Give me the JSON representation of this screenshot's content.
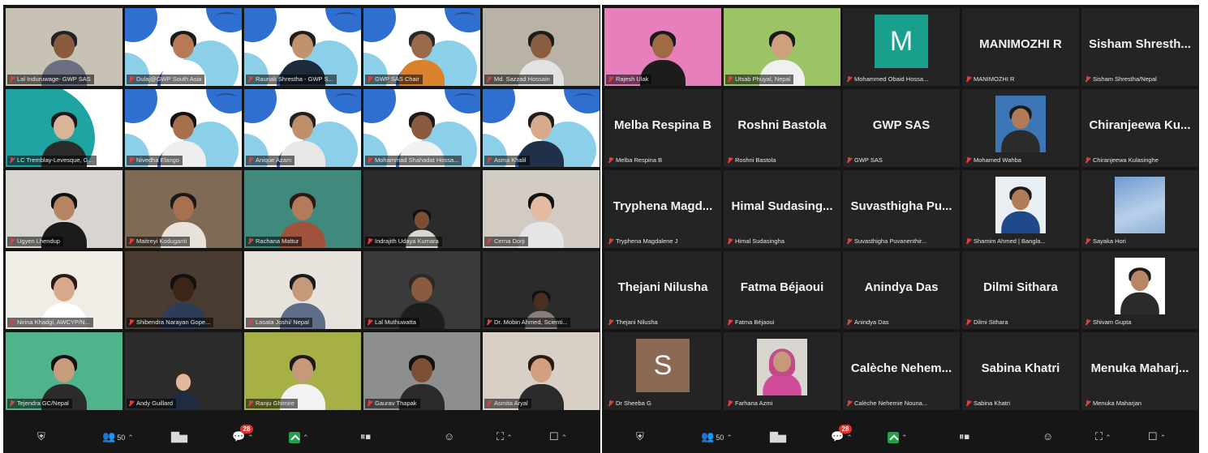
{
  "window": {
    "title": "Zoom meeting gallery view"
  },
  "frames": [
    {
      "id": "left",
      "tiles": [
        {
          "type": "video",
          "name": "Lal Induruwage- GWP SAS",
          "bg": "#c7c2b4",
          "skin": "#8a5a3c",
          "hair": "#222",
          "shirt": "#6b6f82"
        },
        {
          "type": "gwp",
          "name": "Dulaj@GWP South Asia",
          "skin": "#b77a55",
          "hair": "#1a1a1a",
          "shirt": "#ffffff"
        },
        {
          "type": "gwp",
          "name": "Raunak Shrestha - GWP S...",
          "skin": "#c2926c",
          "hair": "#1e1e1e",
          "shirt": "#1d2a3a"
        },
        {
          "type": "gwp",
          "name": "GWP SAS Chair",
          "skin": "#9b6a4d",
          "hair": "#2a2a2a",
          "shirt": "#d9822b"
        },
        {
          "type": "video",
          "name": "Md. Sazzad Hossain",
          "bg": "#b9b2a7",
          "skin": "#8b5d40",
          "hair": "#1b1b1b",
          "shirt": "#e2e2e2"
        },
        {
          "type": "gwp-teal",
          "name": "LC Tremblay-Levesque, G...",
          "skin": "#d7b49a",
          "hair": "#1a1a1a",
          "shirt": "#2b2b2b"
        },
        {
          "type": "gwp",
          "name": "Nivedha Elango",
          "skin": "#a86f4d",
          "hair": "#111",
          "shirt": "#eeeeee"
        },
        {
          "type": "gwp",
          "name": "Anique Azam",
          "skin": "#c08e6a",
          "hair": "#222",
          "shirt": "#e8e8e8"
        },
        {
          "type": "gwp",
          "name": "Mohammad Shahadat Hossa...",
          "skin": "#8a5a3f",
          "hair": "#1a1a1a",
          "shirt": "#f1f1f1",
          "active": true
        },
        {
          "type": "gwp",
          "name": "Asma Khalil",
          "skin": "#d8a98a",
          "hair": "#1d1d1d",
          "shirt": "#203048"
        },
        {
          "type": "video",
          "name": "Ugyen Lhendup",
          "bg": "#d8d4cf",
          "skin": "#b68663",
          "hair": "#111",
          "shirt": "#1b1b1b"
        },
        {
          "type": "video",
          "name": "Maitreyi Koduganti",
          "bg": "#7f6a55",
          "skin": "#a7714f",
          "hair": "#1a1a1a",
          "shirt": "#e9e2da"
        },
        {
          "type": "video",
          "name": "Rachana Mattur",
          "bg": "#3f8a7d",
          "skin": "#b37b5b",
          "hair": "#2a1a12",
          "shirt": "#a0523b"
        },
        {
          "type": "video",
          "name": "Indrajith Udaya Kumara",
          "bg": "#2b2b2b",
          "skin": "#7c4f35",
          "hair": "#111",
          "shirt": "#d9d5cf",
          "small": true
        },
        {
          "type": "video",
          "name": "Cerna Dorji",
          "bg": "#d1cbc3",
          "skin": "#e2bba0",
          "hair": "#111",
          "shirt": "#e5e5e5"
        },
        {
          "type": "video",
          "name": "Nirina Khadgi, AWCYP/N...",
          "bg": "#f0ece6",
          "skin": "#d8a98d",
          "hair": "#2a1a12",
          "shirt": "#ffffff"
        },
        {
          "type": "video",
          "name": "Shibendra Narayan Gope...",
          "bg": "#4a3c31",
          "skin": "#3b2418",
          "hair": "#111",
          "shirt": "#2c3d5a"
        },
        {
          "type": "video",
          "name": "Lasata Joshi/ Nepal",
          "bg": "#e7e3dc",
          "skin": "#c59a7b",
          "hair": "#1a1a1a",
          "shirt": "#5f6e88"
        },
        {
          "type": "video",
          "name": "Lal Muthuwatta",
          "bg": "#3a3a3a",
          "skin": "#8a5b3e",
          "hair": "#2a2a2a",
          "shirt": "#1e1e1e"
        },
        {
          "type": "video",
          "name": "Dr. Mobin Ahmed, Scienti...",
          "bg": "#2b2b2b",
          "skin": "#4a2f20",
          "hair": "#111",
          "shirt": "#8a7e7a",
          "small": true
        },
        {
          "type": "video",
          "name": "Tejendra GC/Nepal",
          "bg": "#4fb48b",
          "skin": "#c99c7c",
          "hair": "#111",
          "shirt": "#2b2b2b"
        },
        {
          "type": "video",
          "name": "Andy Guillard",
          "bg": "#2b2b2b",
          "skin": "#e0b89c",
          "hair": "#3a2a1a",
          "shirt": "#1e2b40",
          "small": true
        },
        {
          "type": "video",
          "name": "Ranju Ghimire",
          "bg": "#a6b046",
          "skin": "#c8987a",
          "hair": "#1a1a1a",
          "shirt": "#f2f2f2"
        },
        {
          "type": "video",
          "name": "Gaurav Thapak",
          "bg": "#8c8f8e",
          "skin": "#7d4f35",
          "hair": "#111",
          "shirt": "#2a2a2a"
        },
        {
          "type": "video",
          "name": "Asmita Aryal",
          "bg": "#d8cfc7",
          "skin": "#d2a081",
          "hair": "#2a1a12",
          "shirt": "#2b2b2b"
        }
      ],
      "toolbar": {
        "participants_count": "50",
        "chat_badge": "28"
      }
    },
    {
      "id": "right",
      "tiles": [
        {
          "type": "video",
          "name": "Rajesh Ulak",
          "bg": "#e77fbd",
          "skin": "#a06a45",
          "hair": "#1a1a1a",
          "shirt": "#1c1c1c"
        },
        {
          "type": "video",
          "name": "Utsab Phuyal, Nepal",
          "bg": "#9cc466",
          "skin": "#d0a07d",
          "hair": "#1a1a1a",
          "shirt": "#f0f0f0"
        },
        {
          "type": "letter",
          "letter": "M",
          "color": "#18a08c",
          "name": "Mohammed Obaid Hossa..."
        },
        {
          "type": "text",
          "big": "MANIMOZHI R",
          "name": "MANIMOZHI R"
        },
        {
          "type": "text",
          "big": "Sisham Shresth...",
          "name": "Sisham Shrestha/Nepal"
        },
        {
          "type": "text",
          "big": "Melba Respina B",
          "name": "Melba Respina B"
        },
        {
          "type": "text",
          "big": "Roshni Bastola",
          "name": "Roshni Bastola"
        },
        {
          "type": "text",
          "big": "GWP SAS",
          "name": "GWP SAS"
        },
        {
          "type": "photo",
          "bg": "#3c76b5",
          "skin": "#b07b58",
          "hair": "#1a1a1a",
          "shirt": "#2b2b2b",
          "name": "Mohamed Wahba"
        },
        {
          "type": "text",
          "big": "Chiranjeewa Ku...",
          "name": "Chiranjeewa Kulasinghe"
        },
        {
          "type": "text",
          "big": "Tryphena Magd...",
          "name": "Tryphena Magdalene J"
        },
        {
          "type": "text",
          "big": "Himal Sudasing...",
          "name": "Himal Sudasingha"
        },
        {
          "type": "text",
          "big": "Suvasthigha Pu...",
          "name": "Suvasthigha Puvanenthir..."
        },
        {
          "type": "photo",
          "bg": "#e8eef2",
          "skin": "#b07b58",
          "hair": "#1a1a1a",
          "shirt": "#1e4a8c",
          "name": "Shamim Ahmed | Bangla..."
        },
        {
          "type": "photo",
          "bg": "#8fb3d8",
          "sky": true,
          "name": "Sayaka Hori"
        },
        {
          "type": "text",
          "big": "Thejani Nilusha",
          "name": "Thejani Nilusha"
        },
        {
          "type": "text",
          "big": "Fatma Béjaoui",
          "name": "Fatma Béjaoui"
        },
        {
          "type": "text",
          "big": "Anindya Das",
          "name": "Anindya Das"
        },
        {
          "type": "text",
          "big": "Dilmi Sithara",
          "name": "Dilmi Sithara"
        },
        {
          "type": "photo",
          "bg": "#ffffff",
          "skin": "#b88565",
          "hair": "#1a1a1a",
          "shirt": "#2b2b2b",
          "name": "Shivam Gupta"
        },
        {
          "type": "letter",
          "letter": "S",
          "color": "#8b6a55",
          "name": "Dr Sheeba G"
        },
        {
          "type": "photo",
          "bg": "#d9d6cf",
          "skin": "#c6997a",
          "hair": "#c04a8a",
          "shirt": "#d04c9a",
          "hijab": true,
          "name": "Farhana Azmi"
        },
        {
          "type": "text",
          "big": "Calèche Nehem...",
          "name": "Calèche Nehemie Nouna..."
        },
        {
          "type": "text",
          "big": "Sabina Khatri",
          "name": "Sabina Khatri"
        },
        {
          "type": "text",
          "big": "Menuka Maharj...",
          "name": "Menuka Maharjan"
        }
      ],
      "toolbar": {
        "participants_count": "50",
        "chat_badge": "28"
      }
    }
  ]
}
